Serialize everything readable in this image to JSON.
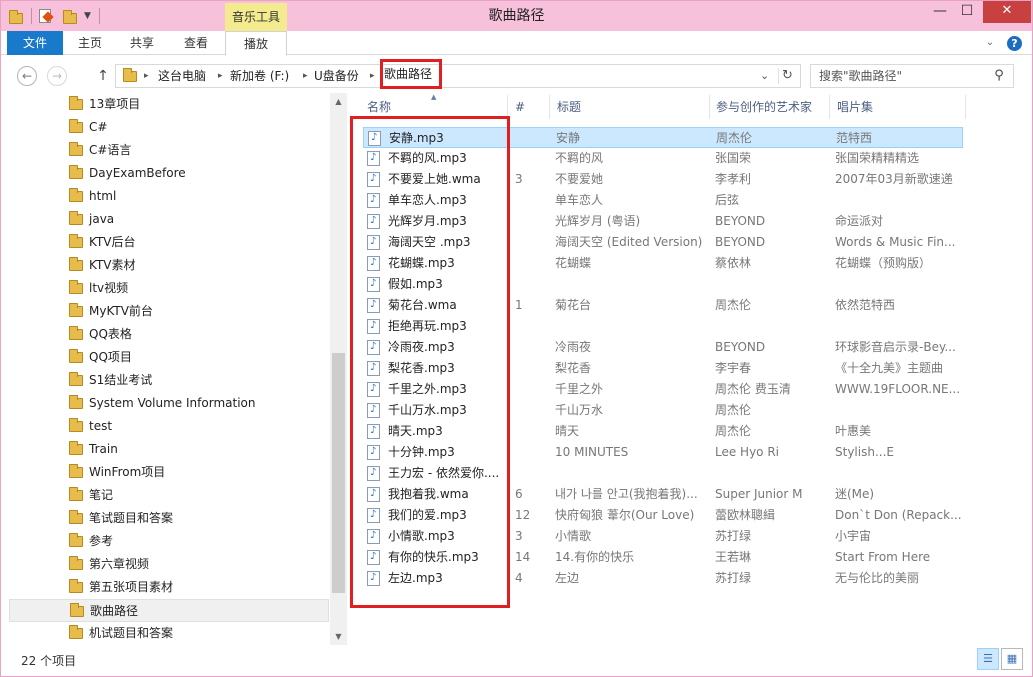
{
  "window": {
    "title": "歌曲路径",
    "context_tab": "音乐工具",
    "minimize": "—",
    "maximize": "☐",
    "close": "✕"
  },
  "ribbon": {
    "tabs": [
      "文件",
      "主页",
      "共享",
      "查看",
      "播放"
    ],
    "collapse_glyph": "⌄",
    "help_glyph": "?"
  },
  "address": {
    "back_glyph": "←",
    "forward_glyph": "→",
    "up_glyph": "↑",
    "crumbs": [
      "这台电脑",
      "新加卷 (F:)",
      "U盘备份",
      "歌曲路径"
    ],
    "separator": "▸",
    "dropdown_glyph": "⌄",
    "refresh_glyph": "↻"
  },
  "search": {
    "placeholder": "搜索\"歌曲路径\"",
    "icon_glyph": "⚲"
  },
  "nav": {
    "items": [
      "13章项目",
      "C#",
      "C#语言",
      "DayExamBefore",
      "html",
      "java",
      "KTV后台",
      "KTV素材",
      "ltv视频",
      "MyKTV前台",
      "QQ表格",
      "QQ项目",
      "S1结业考试",
      "System Volume Information",
      "test",
      "Train",
      "WinFrom项目",
      "笔记",
      "笔试题目和答案",
      "参考",
      "第六章视频",
      "第五张项目素材",
      "歌曲路径",
      "机试题目和答案"
    ],
    "selected_index": 22,
    "scroll_up_glyph": "▲",
    "scroll_down_glyph": "▼"
  },
  "columns": {
    "name": "名称",
    "num": "#",
    "title": "标题",
    "artist": "参与创作的艺术家",
    "album": "唱片集",
    "sort_glyph": "▲"
  },
  "files": [
    {
      "name": "安静.mp3",
      "num": "",
      "title": "安静",
      "artist": "周杰伦",
      "album": "范特西"
    },
    {
      "name": "不羁的风.mp3",
      "num": "",
      "title": "不羁的风",
      "artist": "张国荣",
      "album": "张国荣精精精选"
    },
    {
      "name": "不要爱上她.wma",
      "num": "3",
      "title": "不要爱她",
      "artist": "李孝利",
      "album": "2007年03月新歌速递"
    },
    {
      "name": "单车恋人.mp3",
      "num": "",
      "title": "单车恋人",
      "artist": "后弦",
      "album": ""
    },
    {
      "name": "光辉岁月.mp3",
      "num": "",
      "title": "光辉岁月 (粤语)",
      "artist": "BEYOND",
      "album": "命运派对"
    },
    {
      "name": "海阔天空 .mp3",
      "num": "",
      "title": "海阔天空 (Edited Version)",
      "artist": "BEYOND",
      "album": "Words & Music Fin..."
    },
    {
      "name": "花蝴蝶.mp3",
      "num": "",
      "title": "花蝴蝶",
      "artist": "蔡依林",
      "album": "花蝴蝶（预购版）"
    },
    {
      "name": "假如.mp3",
      "num": "",
      "title": "",
      "artist": "",
      "album": ""
    },
    {
      "name": "菊花台.wma",
      "num": "1",
      "title": "菊花台",
      "artist": "周杰伦",
      "album": "依然范特西"
    },
    {
      "name": "拒绝再玩.mp3",
      "num": "",
      "title": "",
      "artist": "",
      "album": ""
    },
    {
      "name": "冷雨夜.mp3",
      "num": "",
      "title": "冷雨夜",
      "artist": "BEYOND",
      "album": "环球影音启示录-Bey..."
    },
    {
      "name": "梨花香.mp3",
      "num": "",
      "title": "梨花香",
      "artist": "李宇春",
      "album": "《十全九美》主题曲"
    },
    {
      "name": "千里之外.mp3",
      "num": "",
      "title": "千里之外",
      "artist": "周杰伦 费玉清",
      "album": "WWW.19FLOOR.NE..."
    },
    {
      "name": "千山万水.mp3",
      "num": "",
      "title": "千山万水",
      "artist": "周杰伦",
      "album": ""
    },
    {
      "name": "晴天.mp3",
      "num": "",
      "title": "晴天",
      "artist": "周杰伦",
      "album": "叶惠美"
    },
    {
      "name": "十分钟.mp3",
      "num": "",
      "title": "10 MINUTES",
      "artist": "Lee Hyo Ri",
      "album": "Stylish...E"
    },
    {
      "name": "王力宏 - 依然爱你....",
      "num": "",
      "title": "",
      "artist": "",
      "album": ""
    },
    {
      "name": "我抱着我.wma",
      "num": "6",
      "title": "내가 나를 안고(我抱着我)...",
      "artist": "Super Junior M",
      "album": "迷(Me)"
    },
    {
      "name": "我们的爱.mp3",
      "num": "12",
      "title": "快府匈狼 葦尔(Our Love)",
      "artist": "蕾欧林聰緝",
      "album": "Don`t Don (Repack..."
    },
    {
      "name": "小情歌.mp3",
      "num": "3",
      "title": "小情歌",
      "artist": "苏打绿",
      "album": "小宇宙"
    },
    {
      "name": "有你的快乐.mp3",
      "num": "14",
      "title": "14.有你的快乐",
      "artist": "王若琳",
      "album": "Start From Here"
    },
    {
      "name": "左边.mp3",
      "num": "4",
      "title": "左边",
      "artist": "苏打绿",
      "album": "无与伦比的美丽"
    }
  ],
  "file_icon_glyph": "♪",
  "status": {
    "count": "22 个项目",
    "details_view_glyph": "☰",
    "icons_view_glyph": "▦"
  }
}
